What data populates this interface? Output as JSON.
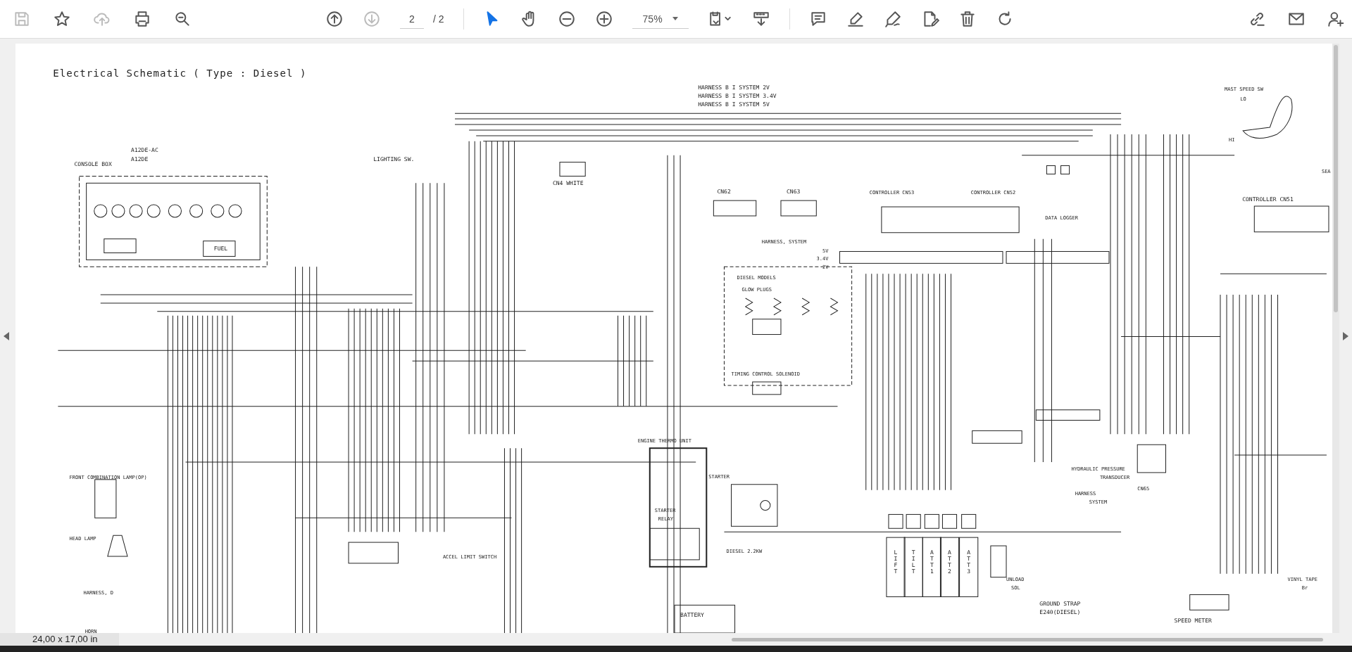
{
  "toolbar": {
    "page_current": "2",
    "page_total": "/ 2",
    "zoom": "75%"
  },
  "document": {
    "labels": [
      "Electrical Schematic ( Type : Diesel )",
      "CONSOLE BOX",
      "A12DE-AC",
      "A12DE",
      "CN4 WHITE",
      "HARNESS B I SYSTEM 2V",
      "HARNESS B I SYSTEM 3.4V",
      "HARNESS B I SYSTEM 5V",
      "MAST SPEED SW",
      "LO",
      "HI",
      "SEA",
      "CN62",
      "CN63",
      "CONTROLLER CN53",
      "CONTROLLER CN52",
      "DATA LOGGER",
      "CONTROLLER CN51",
      "HARNESS, SYSTEM",
      "5V",
      "3.4V",
      "2V",
      "DIESEL MODELS",
      "GLOW PLUGS",
      "TIMING CONTROL SOLENOID",
      "ENGINE THERMO UNIT",
      "STARTER",
      "STARTER",
      "RELAY",
      "DIESEL 2.2KW",
      "BATTERY",
      "FRONT COMBINATION LAMP(OP)",
      "HEAD LAMP",
      "HARNESS, D",
      "HORN",
      "ACCEL LIMIT SWITCH",
      "HYDRAULIC PRESSURE",
      "TRANSDUCER",
      "HARNESS",
      "SYSTEM",
      "CN65",
      "UNLOAD",
      "SOL",
      "GROUND STRAP",
      "E240(DIESEL)",
      "SPEED METER",
      "VINYL TAPE",
      "Br",
      "LIGHTING SW.",
      "FUEL"
    ],
    "valves": [
      "LIFT",
      "TILT",
      "ATT1",
      "ATT2",
      "ATT3"
    ]
  },
  "status_bar": {
    "page_size": "24,00 x 17,00 in"
  }
}
